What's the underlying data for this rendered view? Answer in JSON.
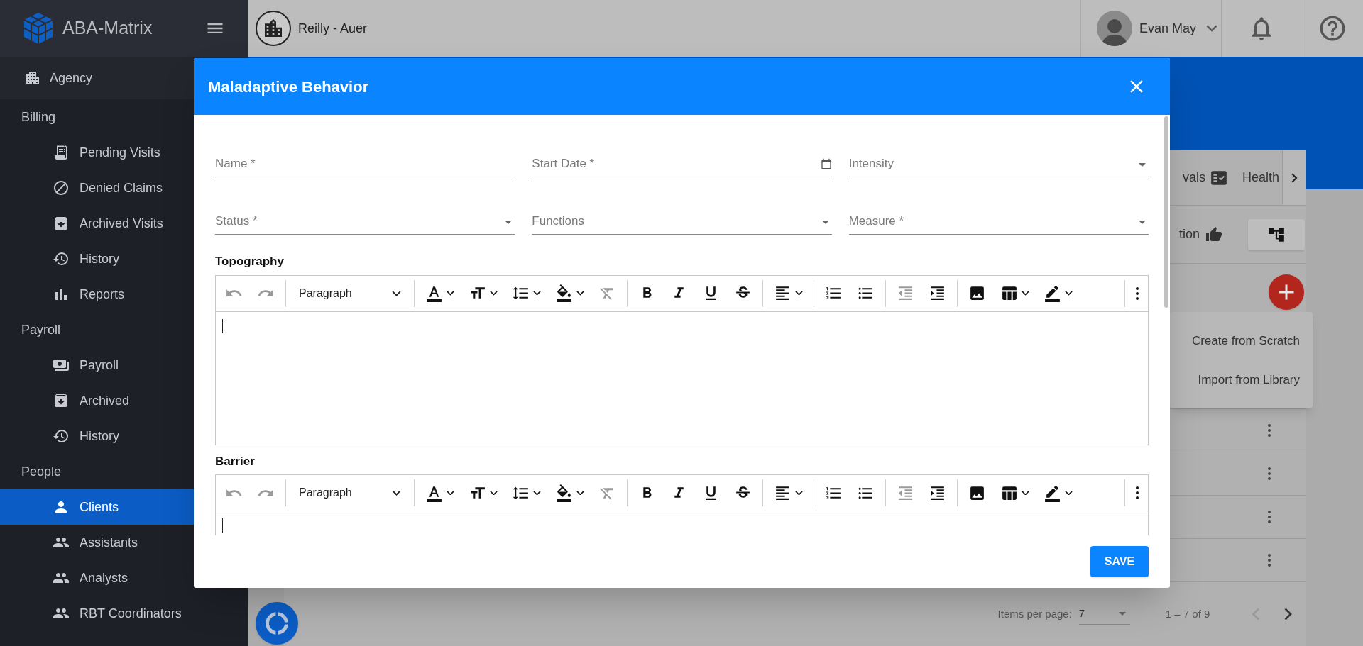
{
  "sidebar": {
    "brand": "ABA-Matrix",
    "items": [
      {
        "kind": "top",
        "label": "Agency",
        "selected": false
      },
      {
        "kind": "header",
        "label": "Billing"
      },
      {
        "kind": "item",
        "label": "Pending Visits",
        "selected": false
      },
      {
        "kind": "item",
        "label": "Denied Claims",
        "selected": false
      },
      {
        "kind": "item",
        "label": "Archived Visits",
        "selected": false
      },
      {
        "kind": "item",
        "label": "History",
        "selected": false
      },
      {
        "kind": "item",
        "label": "Reports",
        "selected": false
      },
      {
        "kind": "header",
        "label": "Payroll"
      },
      {
        "kind": "item",
        "label": "Payroll",
        "selected": false
      },
      {
        "kind": "item",
        "label": "Archived",
        "selected": false
      },
      {
        "kind": "item",
        "label": "History",
        "selected": false
      },
      {
        "kind": "header",
        "label": "People"
      },
      {
        "kind": "item",
        "label": "Clients",
        "selected": true
      },
      {
        "kind": "item",
        "label": "Assistants",
        "selected": false
      },
      {
        "kind": "item",
        "label": "Analysts",
        "selected": false
      },
      {
        "kind": "item",
        "label": "RBT Coordinators",
        "selected": false
      }
    ]
  },
  "topbar": {
    "organization": "Reilly - Auer",
    "user": "Evan May"
  },
  "background": {
    "tabs": [
      "vals",
      "Health"
    ],
    "action_label": "tion",
    "menu": [
      "Create from Scratch",
      "Import from Library"
    ],
    "pagination": {
      "label": "Items per page:",
      "value": "7",
      "range": "1 – 7 of 9"
    }
  },
  "modal": {
    "title": "Maladaptive Behavior",
    "fields": [
      {
        "kind": "text",
        "placeholder": "Name *"
      },
      {
        "kind": "date",
        "placeholder": "Start Date *"
      },
      {
        "kind": "select",
        "placeholder": "Intensity"
      },
      {
        "kind": "select",
        "placeholder": "Status *"
      },
      {
        "kind": "select",
        "placeholder": "Functions"
      },
      {
        "kind": "select",
        "placeholder": "Measure *"
      }
    ],
    "editors": [
      {
        "label": "Topography",
        "format": "Paragraph"
      },
      {
        "label": "Barrier",
        "format": "Paragraph"
      }
    ],
    "save": "SAVE"
  }
}
